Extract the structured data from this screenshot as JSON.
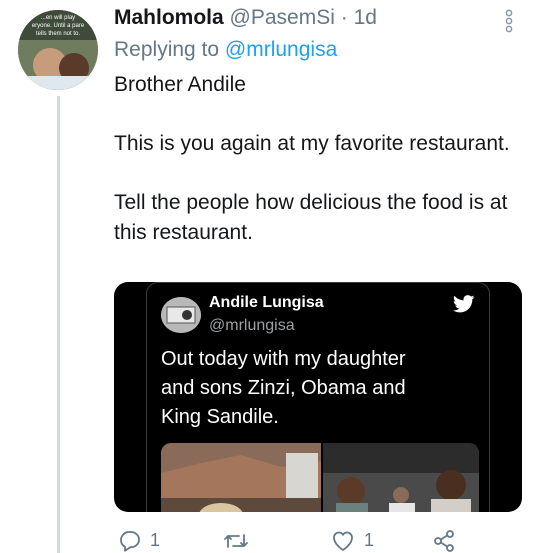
{
  "tweet": {
    "author_name": "Mahlomola",
    "author_handle": "@PasemSi",
    "separator": "·",
    "time": "1d",
    "replying_prefix": "Replying to",
    "replying_mention": "@mrlungisa",
    "paragraphs": [
      "Brother Andile",
      "This is you again at my favorite restaurant.",
      "Tell the people how delicious the food is at this restaurant."
    ],
    "avatar_overlay_text": [
      "...en will play",
      "eryone. Until a pare",
      "tells them not to."
    ]
  },
  "quoted": {
    "author_name": "Andile Lungisa",
    "author_handle": "@mrlungisa",
    "text_lines": [
      "Out today with my daughter",
      "and sons Zinzi, Obama and",
      "King Sandile."
    ]
  },
  "actions": {
    "reply_count": "1",
    "retweet_count": "",
    "like_count": "1"
  },
  "colors": {
    "accent": "#1da1f2",
    "secondary_text": "#657786",
    "thread_line": "#cfd9de"
  }
}
